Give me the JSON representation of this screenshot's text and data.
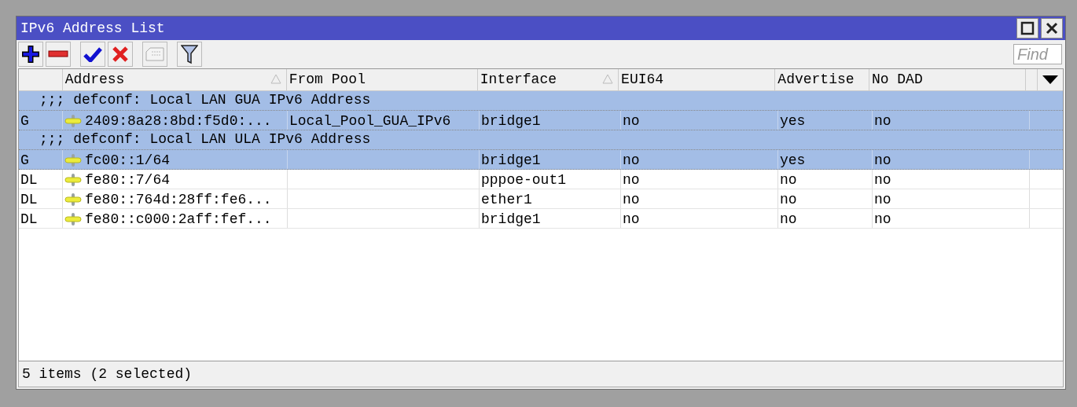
{
  "window": {
    "title": "IPv6 Address List"
  },
  "toolbar": {
    "find_placeholder": "Find"
  },
  "table": {
    "columns": [
      {
        "sorted": false
      },
      {
        "label": "Address",
        "sorted": true
      },
      {
        "label": "From Pool",
        "sorted": false
      },
      {
        "label": "Interface",
        "sorted": true
      },
      {
        "label": "EUI64",
        "sorted": false
      },
      {
        "label": "Advertise",
        "sorted": false
      },
      {
        "label": "No DAD",
        "sorted": false
      }
    ],
    "rows": [
      {
        "kind": "comment",
        "selected": true,
        "text": ";;; defconf: Local LAN GUA IPv6 Address"
      },
      {
        "kind": "address",
        "selected": true,
        "cells": [
          "G",
          "2409:8a28:8bd:f5d0:...",
          "Local_Pool_GUA_IPv6",
          "bridge1",
          "no",
          "yes",
          "no"
        ]
      },
      {
        "kind": "comment",
        "selected": true,
        "text": ";;; defconf: Local LAN ULA IPv6 Address"
      },
      {
        "kind": "address",
        "selected": true,
        "cells": [
          "G",
          "fc00::1/64",
          "",
          "bridge1",
          "no",
          "yes",
          "no"
        ]
      },
      {
        "kind": "address",
        "selected": false,
        "cells": [
          "DL",
          "fe80::7/64",
          "",
          "pppoe-out1",
          "no",
          "no",
          "no"
        ]
      },
      {
        "kind": "address",
        "selected": false,
        "cells": [
          "DL",
          "fe80::764d:28ff:fe6...",
          "",
          "ether1",
          "no",
          "no",
          "no"
        ]
      },
      {
        "kind": "address",
        "selected": false,
        "cells": [
          "DL",
          "fe80::c000:2aff:fef...",
          "",
          "bridge1",
          "no",
          "no",
          "no"
        ]
      }
    ]
  },
  "status_bar": "5 items (2 selected)"
}
